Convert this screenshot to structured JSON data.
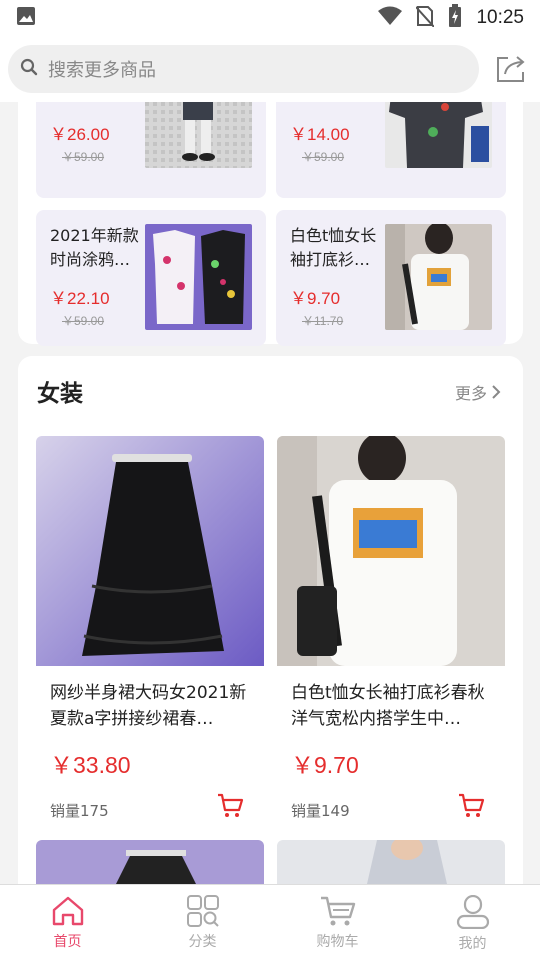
{
  "status_bar": {
    "time": "10:25"
  },
  "search": {
    "placeholder": "搜索更多商品"
  },
  "top_cards": [
    {
      "title": "",
      "price": "￥26.00",
      "old_price": "￥59.00"
    },
    {
      "title": "",
      "price": "￥14.00",
      "old_price": "￥59.00"
    },
    {
      "title": "2021年新款时尚涂鸦…",
      "price": "￥22.10",
      "old_price": "￥59.00"
    },
    {
      "title": "白色t恤女长袖打底衫…",
      "price": "￥9.70",
      "old_price": "￥11.70"
    }
  ],
  "women_section": {
    "title": "女装",
    "more_label": "更多",
    "products": [
      {
        "title": "网纱半身裙大码女2021新夏款a字拼接纱裙春…",
        "price": "￥33.80",
        "sales": "销量175"
      },
      {
        "title": "白色t恤女长袖打底衫春秋洋气宽松内搭学生中…",
        "price": "￥9.70",
        "sales": "销量149"
      }
    ]
  },
  "bottom_nav": [
    {
      "label": "首页",
      "icon": "home-icon",
      "active": true
    },
    {
      "label": "分类",
      "icon": "category-icon",
      "active": false
    },
    {
      "label": "购物车",
      "icon": "cart-icon",
      "active": false
    },
    {
      "label": "我的",
      "icon": "user-icon",
      "active": false
    }
  ],
  "colors": {
    "price_red": "#e52d2d",
    "accent_pink": "#e8486b",
    "card_bg": "#f1eff8"
  }
}
